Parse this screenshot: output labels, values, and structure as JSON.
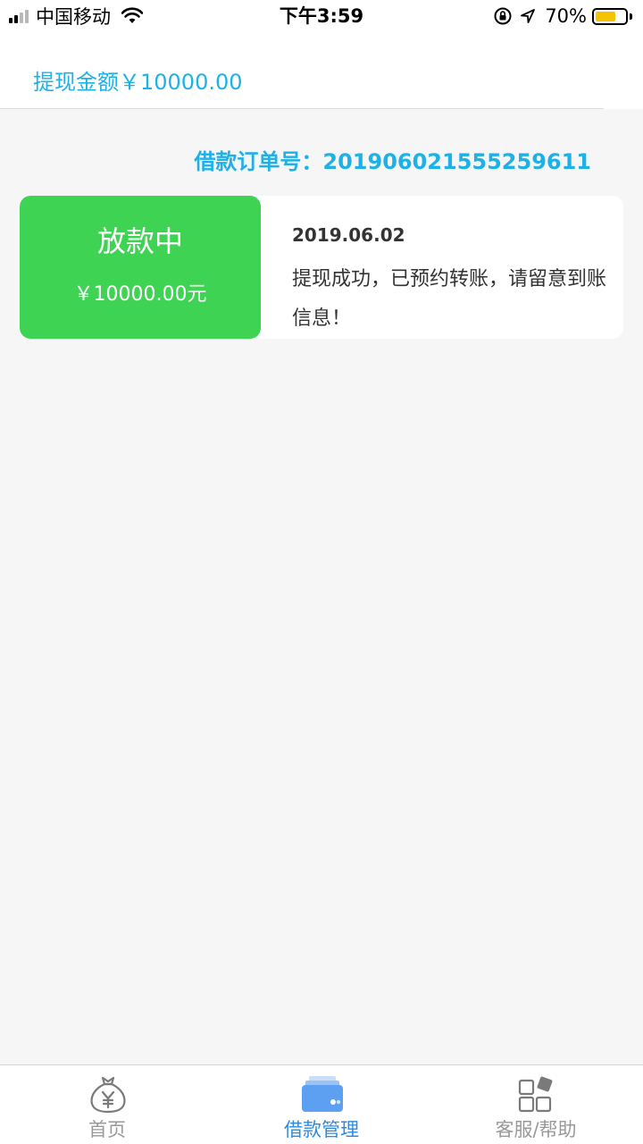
{
  "status_bar": {
    "carrier": "中国移动",
    "time": "下午3:59",
    "battery_percent": "70%",
    "battery_level": 0.7,
    "battery_color": "#f5c400"
  },
  "header": {
    "amount_label": "提现金额￥10000.00"
  },
  "order": {
    "number_label": "借款订单号：20190602155525961​1"
  },
  "record": {
    "status": "放款中",
    "amount": "￥10000.00元",
    "date": "2019.06.02",
    "message": "提现成功，已预约转账，请留意到账信息！"
  },
  "tab_bar": {
    "items": [
      {
        "label": "首页",
        "icon": "money-bag-icon",
        "active": false
      },
      {
        "label": "借款管理",
        "icon": "wallet-icon",
        "active": true
      },
      {
        "label": "客服/帮助",
        "icon": "grid-help-icon",
        "active": false
      }
    ]
  },
  "colors": {
    "accent": "#1eb1e8",
    "status_green": "#3fd353",
    "tab_active": "#2c8be0",
    "tab_inactive": "#999999"
  }
}
